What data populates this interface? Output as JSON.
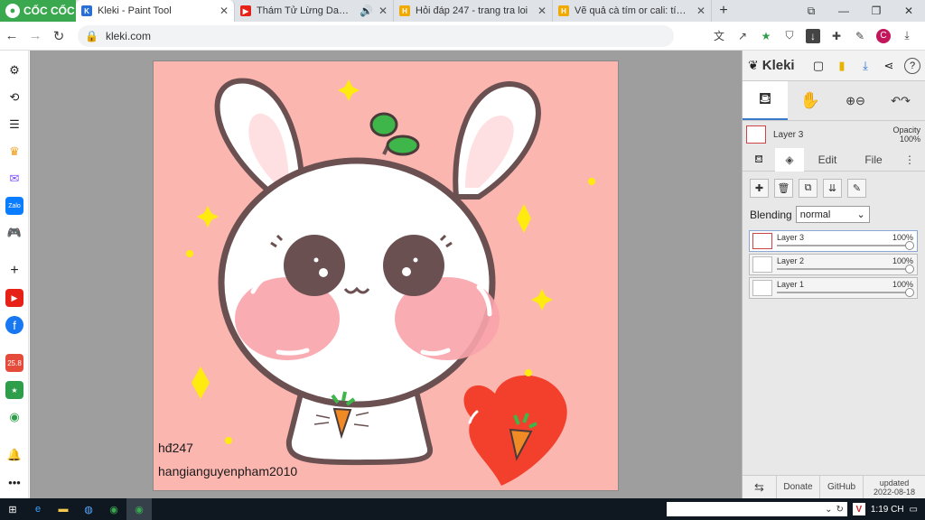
{
  "browser": {
    "brand": "CỐC CỐC",
    "tabs": [
      {
        "title": "Kleki - Paint Tool",
        "active": true,
        "favicon": "kleki-icon"
      },
      {
        "title": "Thám Tử Lừng Danh Co",
        "active": false,
        "favicon": "youtube-icon"
      },
      {
        "title": "Hỏi đáp 247 - trang tra loi",
        "active": false,
        "favicon": "hoidap-icon"
      },
      {
        "title": "Vẽ quả cà tím or cali: tím ng",
        "active": false,
        "favicon": "hoidap-icon"
      }
    ],
    "url": "kleki.com",
    "profile_initial": "C"
  },
  "drawing": {
    "signature_line1": "hđ247",
    "signature_line2": "hangianguyenpham2010"
  },
  "kleki": {
    "logo": "Kleki",
    "current_layer": "Layer 3",
    "opacity_label": "Opacity",
    "opacity_value": "100%",
    "tabs": {
      "edit": "Edit",
      "file": "File"
    },
    "blending_label": "Blending",
    "blending_value": "normal",
    "layers": [
      {
        "name": "Layer 3",
        "opacity": "100%",
        "selected": true
      },
      {
        "name": "Layer 2",
        "opacity": "100%",
        "selected": false
      },
      {
        "name": "Layer 1",
        "opacity": "100%",
        "selected": false
      }
    ],
    "footer": {
      "donate": "Donate",
      "github": "GitHub",
      "updated_label": "updated",
      "updated_date": "2022-08-18"
    }
  },
  "taskbar": {
    "time": "1:19 CH",
    "tray_v": "V"
  },
  "colors": {
    "brand_green": "#3aa84e",
    "canvas_pink": "#fcb6b0",
    "accent_blue": "#3a78c8"
  }
}
